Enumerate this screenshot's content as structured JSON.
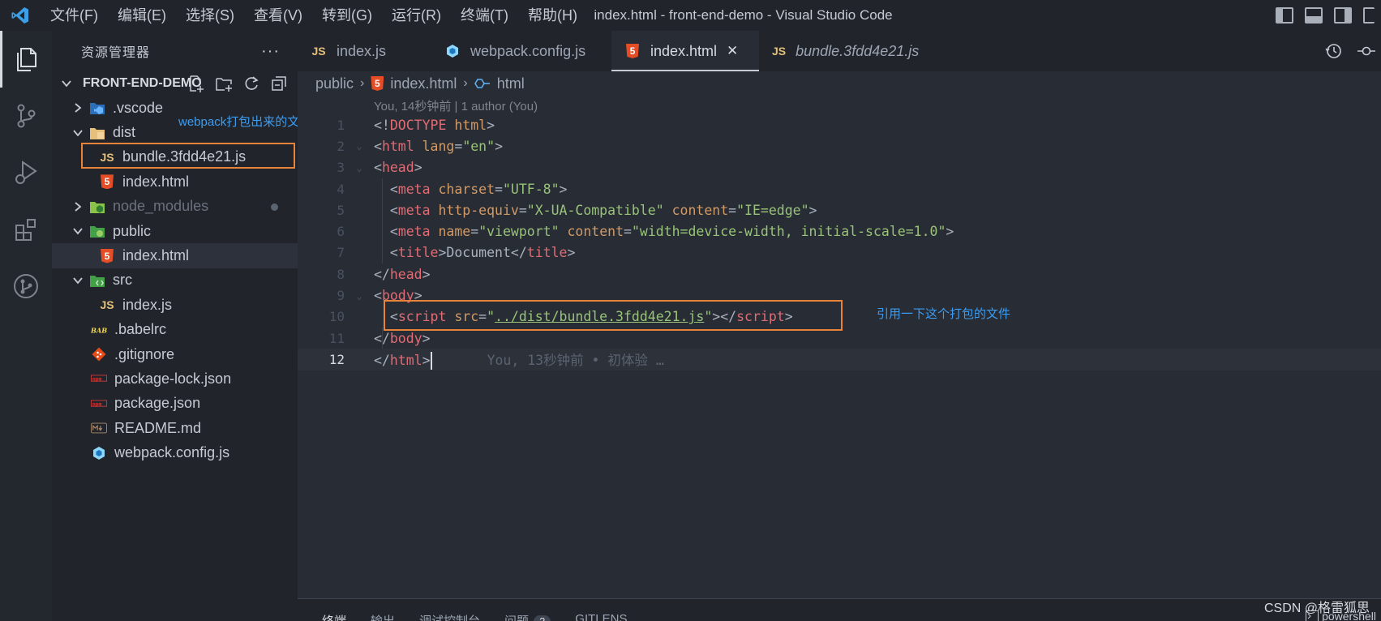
{
  "titlebar": {
    "menu": [
      "文件(F)",
      "编辑(E)",
      "选择(S)",
      "查看(V)",
      "转到(G)",
      "运行(R)",
      "终端(T)",
      "帮助(H)"
    ],
    "window_title": "index.html - front-end-demo - Visual Studio Code"
  },
  "activity_bar": {
    "icons": [
      "explorer-icon",
      "source-control-icon",
      "run-debug-icon",
      "extensions-icon",
      "gitlens-icon"
    ]
  },
  "sidebar": {
    "title": "资源管理器",
    "more": "···",
    "project": "FRONT-END-DEMO",
    "tree": [
      {
        "label": ".vscode",
        "icon": "vscode-folder-icon",
        "type": "folder",
        "expanded": false,
        "depth": 0
      },
      {
        "label": "dist",
        "icon": "dist-folder-icon",
        "type": "folder",
        "expanded": true,
        "depth": 0
      },
      {
        "label": "bundle.3fdd4e21.js",
        "icon": "js-file-icon",
        "type": "file",
        "depth": 1
      },
      {
        "label": "index.html",
        "icon": "html-file-icon",
        "type": "file",
        "depth": 1
      },
      {
        "label": "node_modules",
        "icon": "node-folder-icon",
        "type": "folder",
        "expanded": false,
        "depth": 0,
        "dim": true
      },
      {
        "label": "public",
        "icon": "public-folder-icon",
        "type": "folder",
        "expanded": true,
        "depth": 0
      },
      {
        "label": "index.html",
        "icon": "html-file-icon",
        "type": "file",
        "depth": 1,
        "selected": true
      },
      {
        "label": "src",
        "icon": "src-folder-icon",
        "type": "folder",
        "expanded": true,
        "depth": 0
      },
      {
        "label": "index.js",
        "icon": "js-file-icon",
        "type": "file",
        "depth": 1
      },
      {
        "label": ".babelrc",
        "icon": "babel-file-icon",
        "type": "file",
        "depth": 0
      },
      {
        "label": ".gitignore",
        "icon": "git-file-icon",
        "type": "file",
        "depth": 0
      },
      {
        "label": "package-lock.json",
        "icon": "npm-file-icon",
        "type": "file",
        "depth": 0
      },
      {
        "label": "package.json",
        "icon": "npm-file-icon",
        "type": "file",
        "depth": 0
      },
      {
        "label": "README.md",
        "icon": "markdown-file-icon",
        "type": "file",
        "depth": 0
      },
      {
        "label": "webpack.config.js",
        "icon": "webpack-file-icon",
        "type": "file",
        "depth": 0
      }
    ],
    "annotation": "webpack打包出来的文件"
  },
  "tabs": [
    {
      "label": "index.js",
      "icon": "js-file-icon",
      "active": false,
      "italic": false
    },
    {
      "label": "webpack.config.js",
      "icon": "webpack-file-icon",
      "active": false,
      "italic": false
    },
    {
      "label": "index.html",
      "icon": "html-file-icon",
      "active": true,
      "italic": false
    },
    {
      "label": "bundle.3fdd4e21.js",
      "icon": "js-file-icon",
      "active": false,
      "italic": true
    }
  ],
  "breadcrumb": {
    "folder": "public",
    "file": "index.html",
    "symbol": "html"
  },
  "blame_header": "You, 14秒钟前 | 1 author (You)",
  "code": {
    "lines": [
      [
        [
          "br",
          "<!"
        ],
        [
          "tag",
          "DOCTYPE"
        ],
        [
          "txt",
          " "
        ],
        [
          "attr",
          "html"
        ],
        [
          "br",
          ">"
        ]
      ],
      [
        [
          "br",
          "<"
        ],
        [
          "tag",
          "html"
        ],
        [
          "txt",
          " "
        ],
        [
          "attr",
          "lang"
        ],
        [
          "br",
          "="
        ],
        [
          "str",
          "\"en\""
        ],
        [
          "br",
          ">"
        ]
      ],
      [
        [
          "br",
          "<"
        ],
        [
          "tag",
          "head"
        ],
        [
          "br",
          ">"
        ]
      ],
      [
        [
          "txt",
          "  "
        ],
        [
          "br",
          "<"
        ],
        [
          "tag",
          "meta"
        ],
        [
          "txt",
          " "
        ],
        [
          "attr",
          "charset"
        ],
        [
          "br",
          "="
        ],
        [
          "str",
          "\"UTF-8\""
        ],
        [
          "br",
          ">"
        ]
      ],
      [
        [
          "txt",
          "  "
        ],
        [
          "br",
          "<"
        ],
        [
          "tag",
          "meta"
        ],
        [
          "txt",
          " "
        ],
        [
          "attr",
          "http-equiv"
        ],
        [
          "br",
          "="
        ],
        [
          "str",
          "\"X-UA-Compatible\""
        ],
        [
          "txt",
          " "
        ],
        [
          "attr",
          "content"
        ],
        [
          "br",
          "="
        ],
        [
          "str",
          "\"IE=edge\""
        ],
        [
          "br",
          ">"
        ]
      ],
      [
        [
          "txt",
          "  "
        ],
        [
          "br",
          "<"
        ],
        [
          "tag",
          "meta"
        ],
        [
          "txt",
          " "
        ],
        [
          "attr",
          "name"
        ],
        [
          "br",
          "="
        ],
        [
          "str",
          "\"viewport\""
        ],
        [
          "txt",
          " "
        ],
        [
          "attr",
          "content"
        ],
        [
          "br",
          "="
        ],
        [
          "str",
          "\"width=device-width, initial-scale=1.0\""
        ],
        [
          "br",
          ">"
        ]
      ],
      [
        [
          "txt",
          "  "
        ],
        [
          "br",
          "<"
        ],
        [
          "tag",
          "title"
        ],
        [
          "br",
          ">"
        ],
        [
          "txt",
          "Document"
        ],
        [
          "br",
          "</"
        ],
        [
          "tag",
          "title"
        ],
        [
          "br",
          ">"
        ]
      ],
      [
        [
          "br",
          "</"
        ],
        [
          "tag",
          "head"
        ],
        [
          "br",
          ">"
        ]
      ],
      [
        [
          "br",
          "<"
        ],
        [
          "tag",
          "body"
        ],
        [
          "br",
          ">"
        ]
      ],
      [
        [
          "txt",
          "  "
        ],
        [
          "br",
          "<"
        ],
        [
          "tag",
          "script"
        ],
        [
          "txt",
          " "
        ],
        [
          "attr",
          "src"
        ],
        [
          "br",
          "="
        ],
        [
          "str",
          "\""
        ],
        [
          "link",
          "../dist/bundle.3fdd4e21.js"
        ],
        [
          "str",
          "\""
        ],
        [
          "br",
          "></"
        ],
        [
          "tag",
          "script"
        ],
        [
          "br",
          ">"
        ]
      ],
      [
        [
          "br",
          "</"
        ],
        [
          "tag",
          "body"
        ],
        [
          "br",
          ">"
        ]
      ],
      [
        [
          "br",
          "</"
        ],
        [
          "tag",
          "html"
        ],
        [
          "br",
          ">"
        ]
      ]
    ],
    "current_line": 12,
    "ghost_text": "You, 13秒钟前 • 初体验 …",
    "annotation": "引用一下这个打包的文件"
  },
  "panel": {
    "tabs": [
      "终端",
      "输出",
      "调试控制台",
      "问题",
      "GITLENS"
    ],
    "problems_count": "2",
    "terminal": "powershell"
  },
  "watermark": "CSDN @格雷狐思"
}
